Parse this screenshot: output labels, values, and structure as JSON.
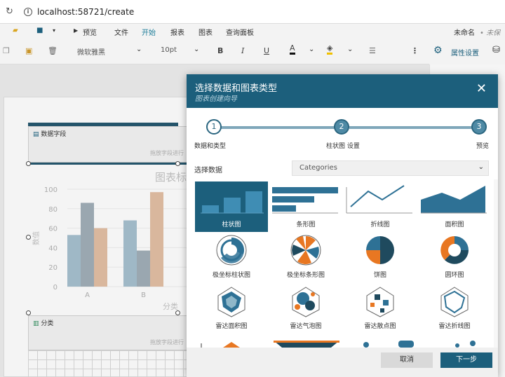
{
  "browser": {
    "url": "localhost:58721/create"
  },
  "menu": {
    "preview": "预览",
    "file": "文件",
    "home": "开始",
    "report": "报表",
    "chart": "图表",
    "query_panel": "查询面板",
    "untitled": "未命名",
    "unsaved": "• 未保存"
  },
  "toolbar": {
    "font_family": "微软雅黑",
    "font_size": "10pt",
    "bold": "B",
    "italic": "I",
    "underline": "U",
    "font_color": "A",
    "properties": "属性设置"
  },
  "canvas": {
    "data_fields": "数据字段",
    "drop_hint": "拖放字段进行",
    "category_zone": "分类",
    "chart_data": {
      "type": "bar",
      "title": "图表标",
      "categories": [
        "A",
        "B"
      ],
      "series": [
        {
          "values": [
            53,
            68
          ],
          "color": "#9fb8c6"
        },
        {
          "values": [
            86,
            37
          ],
          "color": "#9aa7b0"
        },
        {
          "values": [
            60,
            97
          ],
          "color": "#d9b79d"
        }
      ],
      "yticks": [
        "100",
        "80",
        "60",
        "40",
        "20",
        "0"
      ],
      "ylim": [
        0,
        100
      ],
      "ylabel": "数值",
      "xlabel": "分类"
    }
  },
  "dialog": {
    "title": "选择数据和图表类型",
    "subtitle": "图表创建向导",
    "close": "✕",
    "steps": [
      {
        "num": "1",
        "label": "数据和类型"
      },
      {
        "num": "2",
        "label": "柱状图 设置"
      },
      {
        "num": "3",
        "label": "预览"
      }
    ],
    "select_data_label": "选择数据",
    "select_data_value": "Categories",
    "chart_types": [
      "柱状图",
      "条形图",
      "折线图",
      "面积图",
      "极坐标柱状图",
      "极坐标条形图",
      "饼图",
      "圆环图",
      "雷达面积图",
      "雷达气泡图",
      "雷达散点图",
      "雷达折线图"
    ],
    "cancel": "取消",
    "next": "下一步",
    "colors": {
      "header": "#1c5f7c",
      "accent": "#e87722",
      "primary": "#2e7195",
      "dark": "#1f4a5e"
    }
  }
}
